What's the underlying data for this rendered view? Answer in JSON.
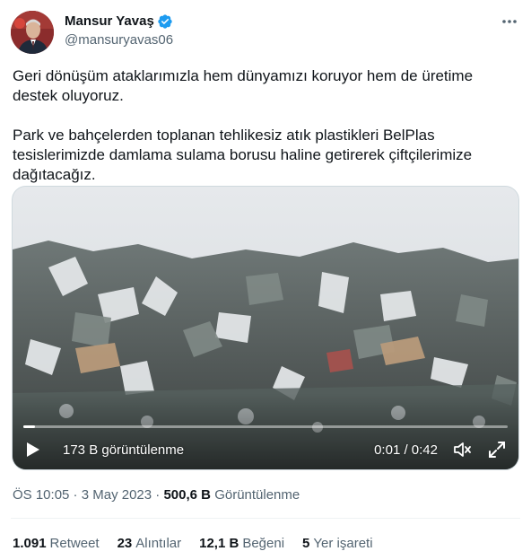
{
  "author": {
    "name": "Mansur Yavaş",
    "handle": "@mansuryavas06",
    "verified_color": "#1d9bf0"
  },
  "tweet": {
    "paragraph1": "Geri dönüşüm ataklarımızla hem dünyamızı koruyor hem de üretime destek oluyoruz.",
    "paragraph2": "Park ve bahçelerden toplanan tehlikesiz atık plastikleri BelPlas tesislerimizde damlama sulama borusu haline getirerek çiftçilerimize dağıtacağız."
  },
  "video": {
    "views_label": "173 B görüntülenme",
    "time_label": "0:01 / 0:42",
    "progress": 0.024,
    "icons": [
      "play-icon",
      "volume-icon",
      "fullscreen-icon"
    ]
  },
  "meta": {
    "time": "ÖS 10:05",
    "date": "3 May 2023",
    "views_count": "500,6 B",
    "views_label": "Görüntülenme"
  },
  "stats": [
    {
      "num": "1.091",
      "label": "Retweet"
    },
    {
      "num": "23",
      "label": "Alıntılar"
    },
    {
      "num": "12,1 B",
      "label": "Beğeni"
    },
    {
      "num": "5",
      "label": "Yer işareti"
    }
  ],
  "colors": {
    "text": "#0f1419",
    "secondary": "#536471",
    "accent": "#1d9bf0"
  }
}
